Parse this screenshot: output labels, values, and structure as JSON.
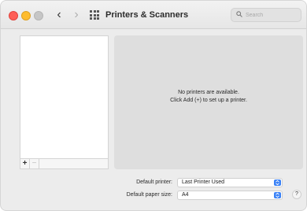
{
  "window": {
    "title": "Printers & Scanners"
  },
  "search": {
    "placeholder": "Search"
  },
  "printer_list": {
    "add_label": "+",
    "remove_label": "−"
  },
  "detail": {
    "message_line1": "No printers are available.",
    "message_line2": "Click Add (+) to set up a printer."
  },
  "settings": {
    "default_printer_label": "Default printer:",
    "default_printer_value": "Last Printer Used",
    "default_paper_label": "Default paper size:",
    "default_paper_value": "A4"
  },
  "help": {
    "label": "?"
  },
  "colors": {
    "close": "#fe5f57",
    "minimize": "#febc2e",
    "zoom_inactive": "#c6c6c6",
    "accent": "#3b82f6"
  }
}
